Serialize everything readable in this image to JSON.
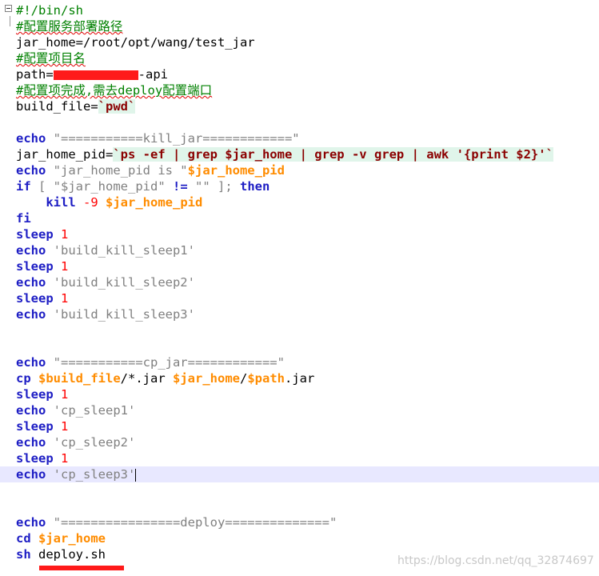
{
  "lines": {
    "shebang": "#!/bin/sh",
    "cmt_deploy_path": "#配置服务部署路径",
    "jar_home_assign": "jar_home=/root/opt/wang/test_jar",
    "cmt_project_name": "#配置项目名",
    "path_prefix": "path=",
    "path_suffix": "-api",
    "cmt_after_done": "#配置项完成,需去deploy配置端口",
    "build_file_prefix": "build_file=",
    "build_file_bq": "`pwd`",
    "echo_kill_str": "\"===========kill_jar============\"",
    "pid_prefix": "jar_home_pid=",
    "pid_bq": "`ps -ef | grep $jar_home | grep -v grep | awk '{print $2}'`",
    "echo_pid_str": "\"jar_home_pid is \"",
    "if_cond_open": "[ \"$jar_home_pid\" ",
    "if_op": "!=",
    "if_cond_close": " \"\" ];",
    "then": "then",
    "kill": "kill",
    "kill_sig": "-9",
    "fi": "fi",
    "sleep": "sleep",
    "echo": "echo",
    "if": "if",
    "cp": "cp",
    "cd": "cd",
    "sh": "sh",
    "one": "1",
    "build_kill_sleep1": "'build_kill_sleep1'",
    "build_kill_sleep2": "'build_kill_sleep2'",
    "build_kill_sleep3": "'build_kill_sleep3'",
    "echo_cp_str": "\"===========cp_jar============\"",
    "var_build_file": "$build_file",
    "var_jar_home": "$jar_home",
    "var_jar_home_pid": "$jar_home_pid",
    "var_path": "$path",
    "cp_glob": "/*.jar ",
    "slash": "/",
    "jar_ext": ".jar",
    "cp_sleep1": "'cp_sleep1'",
    "cp_sleep2": "'cp_sleep2'",
    "cp_sleep3": "'cp_sleep3'",
    "echo_deploy_str": "\"================deploy==============\"",
    "deploy_sh": "deploy.sh"
  },
  "watermark": "https://blog.csdn.net/qq_32874697",
  "colors": {
    "keyword": "#1d1dc4",
    "variable": "#ff8c00",
    "comment": "#008000",
    "string": "#808080",
    "number": "#ff0000",
    "redaction": "#ff1a1a",
    "current_line": "#e8e8ff"
  }
}
